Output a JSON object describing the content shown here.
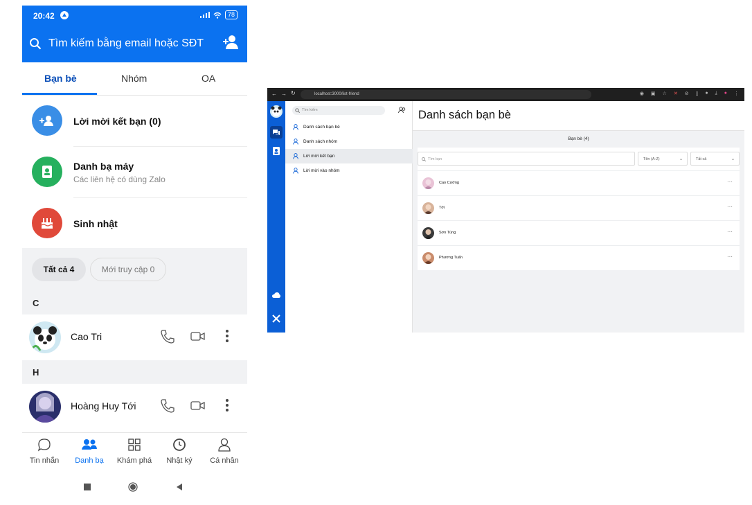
{
  "phone": {
    "status": {
      "time": "20:42",
      "battery": "78"
    },
    "search_placeholder": "Tìm kiếm bằng email hoặc SĐT",
    "tabs": [
      "Bạn bè",
      "Nhóm",
      "OA"
    ],
    "quick_items": [
      {
        "title": "Lời mời kết bạn (0)",
        "subtitle": "",
        "icon": "add-friend-icon",
        "color": "#3a8ee6"
      },
      {
        "title": "Danh bạ máy",
        "subtitle": "Các liên hệ có dùng Zalo",
        "icon": "contact-book-icon",
        "color": "#26b05e"
      },
      {
        "title": "Sinh nhật",
        "subtitle": "",
        "icon": "birthday-cake-icon",
        "color": "#e0493a"
      }
    ],
    "filters": {
      "all": "Tất cả 4",
      "recent": "Mới truy cập 0"
    },
    "sections": [
      {
        "letter": "C",
        "contacts": [
          "Cao Tri"
        ]
      },
      {
        "letter": "H",
        "contacts": [
          "Hoàng Huy Tới"
        ]
      }
    ],
    "bottom_nav": [
      "Tin nhắn",
      "Danh bạ",
      "Khám phá",
      "Nhật ký",
      "Cá nhân"
    ],
    "accent": "#0b72f0"
  },
  "desktop": {
    "url": "localhost:3000/list-friend",
    "sidebar_search_placeholder": "Tìm kiếm",
    "menu": [
      "Danh sách bạn bè",
      "Danh sách nhóm",
      "Lời mời kết bạn",
      "Lời mời vào nhóm"
    ],
    "active_menu_index": 2,
    "page_title": "Danh sách bạn bè",
    "friend_count": "Bạn bè (4)",
    "friend_search_placeholder": "Tìm bạn",
    "sort_option": "Tên (A-Z)",
    "filter_option": "Tất cả",
    "friends": [
      "Cao Cường",
      "Tới",
      "Sơn Tùng",
      "Phương Tuấn"
    ],
    "more_label": "···"
  }
}
